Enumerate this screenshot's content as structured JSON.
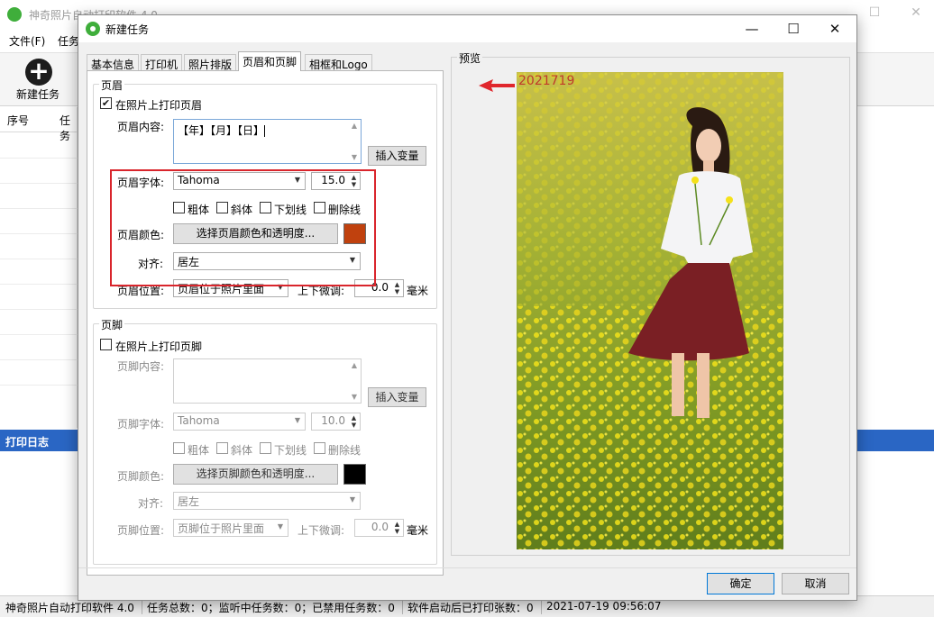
{
  "main_window": {
    "title": "神奇照片自动打印软件 4.0",
    "menu": [
      "文件(F)",
      "任务"
    ],
    "toolbar_new_task": "新建任务",
    "table_headers": [
      "序号",
      "任务"
    ],
    "log_title": "打印日志",
    "status": {
      "app": "神奇照片自动打印软件 4.0",
      "task_total": "任务总数：0；监听中任务数：0；已禁用任务数：0",
      "printed": "软件启动后已打印张数：0",
      "datetime": "2021-07-19 09:56:07"
    }
  },
  "dialog": {
    "title": "新建任务",
    "tabs": [
      {
        "label": "基本信息",
        "active": false
      },
      {
        "label": "打印机",
        "active": false
      },
      {
        "label": "照片排版",
        "active": false
      },
      {
        "label": "页眉和页脚",
        "active": true
      },
      {
        "label": "相框和Logo",
        "active": false
      }
    ],
    "header": {
      "group_title": "页眉",
      "print_checkbox_label": "在照片上打印页眉",
      "print_checked": true,
      "content_label": "页眉内容:",
      "content_value": "【年】【月】【日】",
      "insert_var_button": "插入变量",
      "font_label": "页眉字体:",
      "font_value": "Tahoma",
      "font_size": "15.0",
      "style_options": [
        "粗体",
        "斜体",
        "下划线",
        "删除线"
      ],
      "color_label": "页眉颜色:",
      "color_button": "选择页眉颜色和透明度...",
      "color_value": "#c0410e",
      "align_label": "对齐:",
      "align_value": "居左",
      "position_label": "页眉位置:",
      "position_value": "页眉位于照片里面",
      "offset_label": "上下微调:",
      "offset_value": "0.0",
      "offset_unit": "毫米"
    },
    "footer": {
      "group_title": "页脚",
      "print_checkbox_label": "在照片上打印页脚",
      "print_checked": false,
      "content_label": "页脚内容:",
      "content_value": "",
      "insert_var_button": "插入变量",
      "font_label": "页脚字体:",
      "font_value": "Tahoma",
      "font_size": "10.0",
      "style_options": [
        "粗体",
        "斜体",
        "下划线",
        "删除线"
      ],
      "color_label": "页脚颜色:",
      "color_button": "选择页脚颜色和透明度...",
      "color_value": "#000000",
      "align_label": "对齐:",
      "align_value": "居左",
      "position_label": "页脚位置:",
      "position_value": "页脚位于照片里面",
      "offset_label": "上下微调:",
      "offset_value": "0.0",
      "offset_unit": "毫米"
    },
    "preview": {
      "title": "预览",
      "header_text": "2021719"
    },
    "buttons": {
      "ok": "确定",
      "cancel": "取消"
    }
  }
}
